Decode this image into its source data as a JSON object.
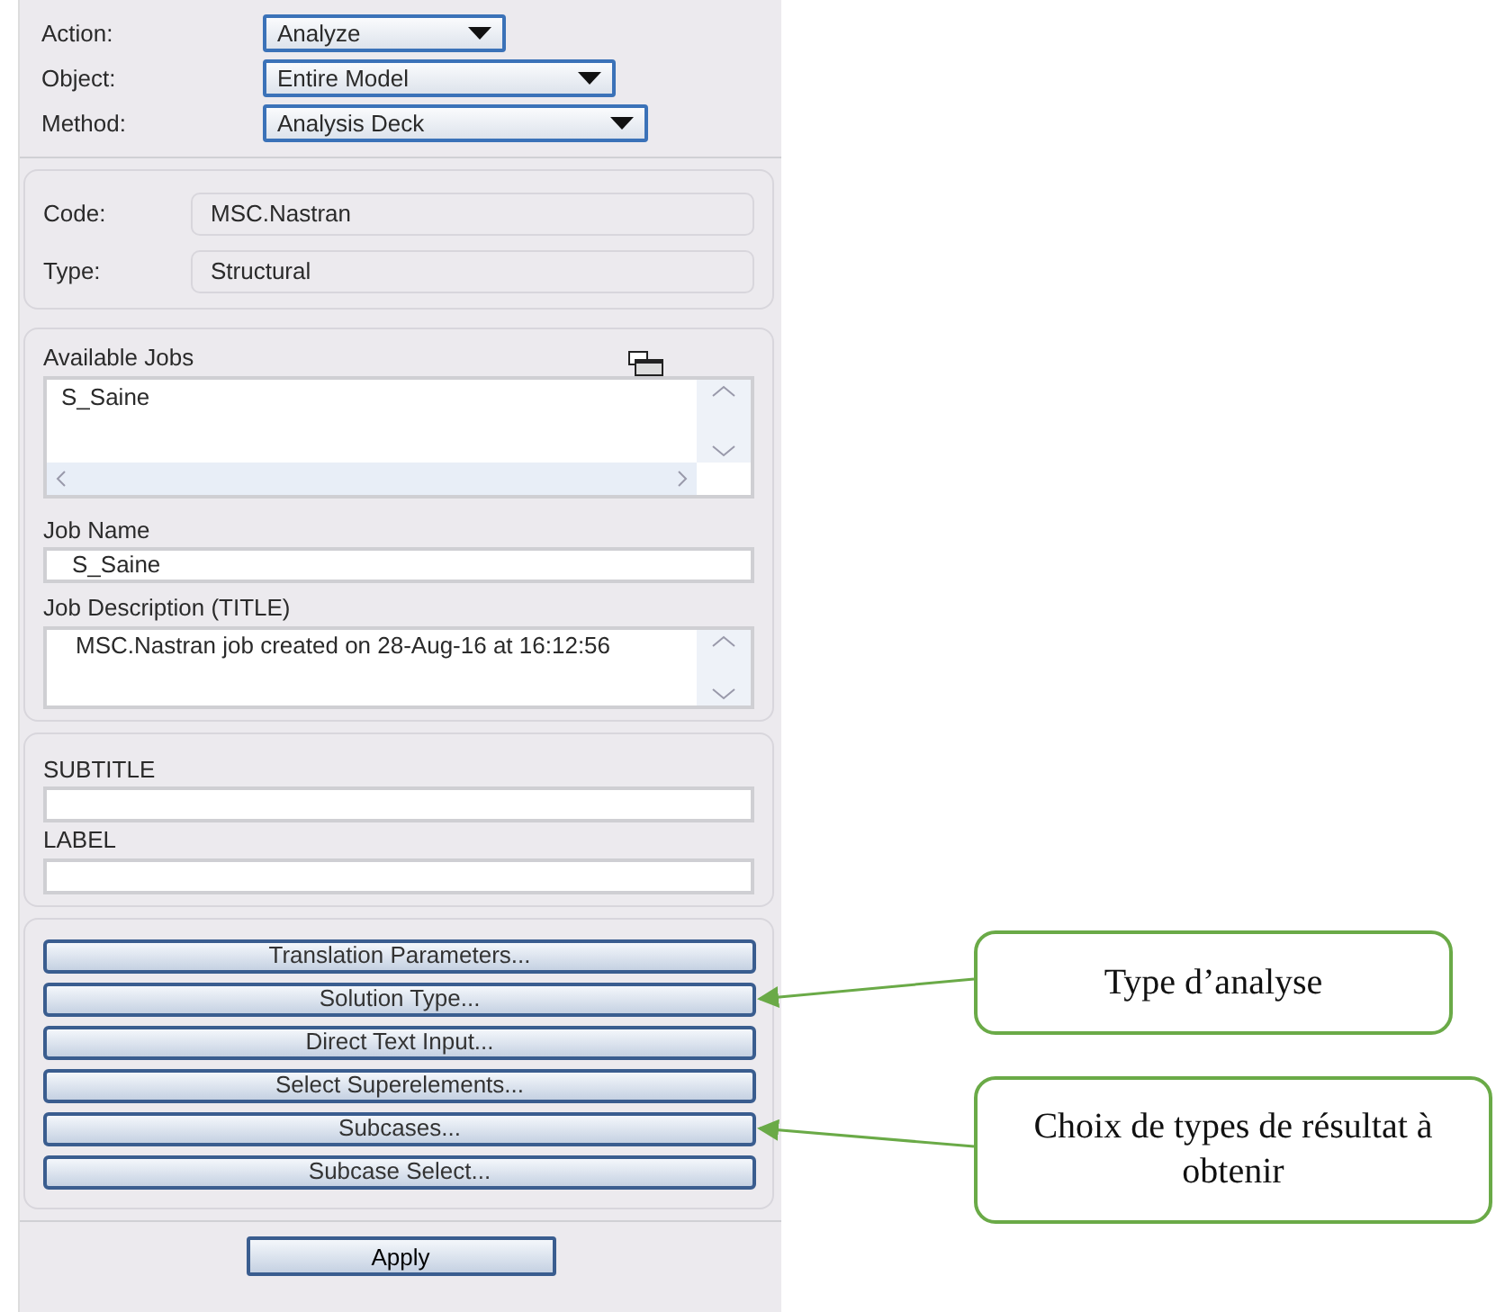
{
  "selectors": [
    {
      "label": "Action:",
      "value": "Analyze"
    },
    {
      "label": "Object:",
      "value": "Entire Model"
    },
    {
      "label": "Method:",
      "value": "Analysis Deck"
    }
  ],
  "solver": [
    {
      "label": "Code:",
      "value": "MSC.Nastran"
    },
    {
      "label": "Type:",
      "value": "Structural"
    }
  ],
  "available_jobs": {
    "label": "Available Jobs",
    "items": [
      "S_Saine"
    ]
  },
  "job_name": {
    "label": "Job Name",
    "value": "S_Saine"
  },
  "job_description": {
    "label": "Job Description (TITLE)",
    "value": "MSC.Nastran job created on 28-Aug-16 at 16:12:56"
  },
  "subtitle": {
    "label": "SUBTITLE"
  },
  "label_field": {
    "label": "LABEL"
  },
  "buttons": [
    "Translation Parameters...",
    "Solution Type...",
    "Direct Text Input...",
    "Select Superelements...",
    "Subcases...",
    "Subcase Select..."
  ],
  "apply": "Apply",
  "annotations": [
    {
      "text": "Type d’analyse"
    },
    {
      "text": "Choix de types de résultat à obtenir"
    }
  ]
}
